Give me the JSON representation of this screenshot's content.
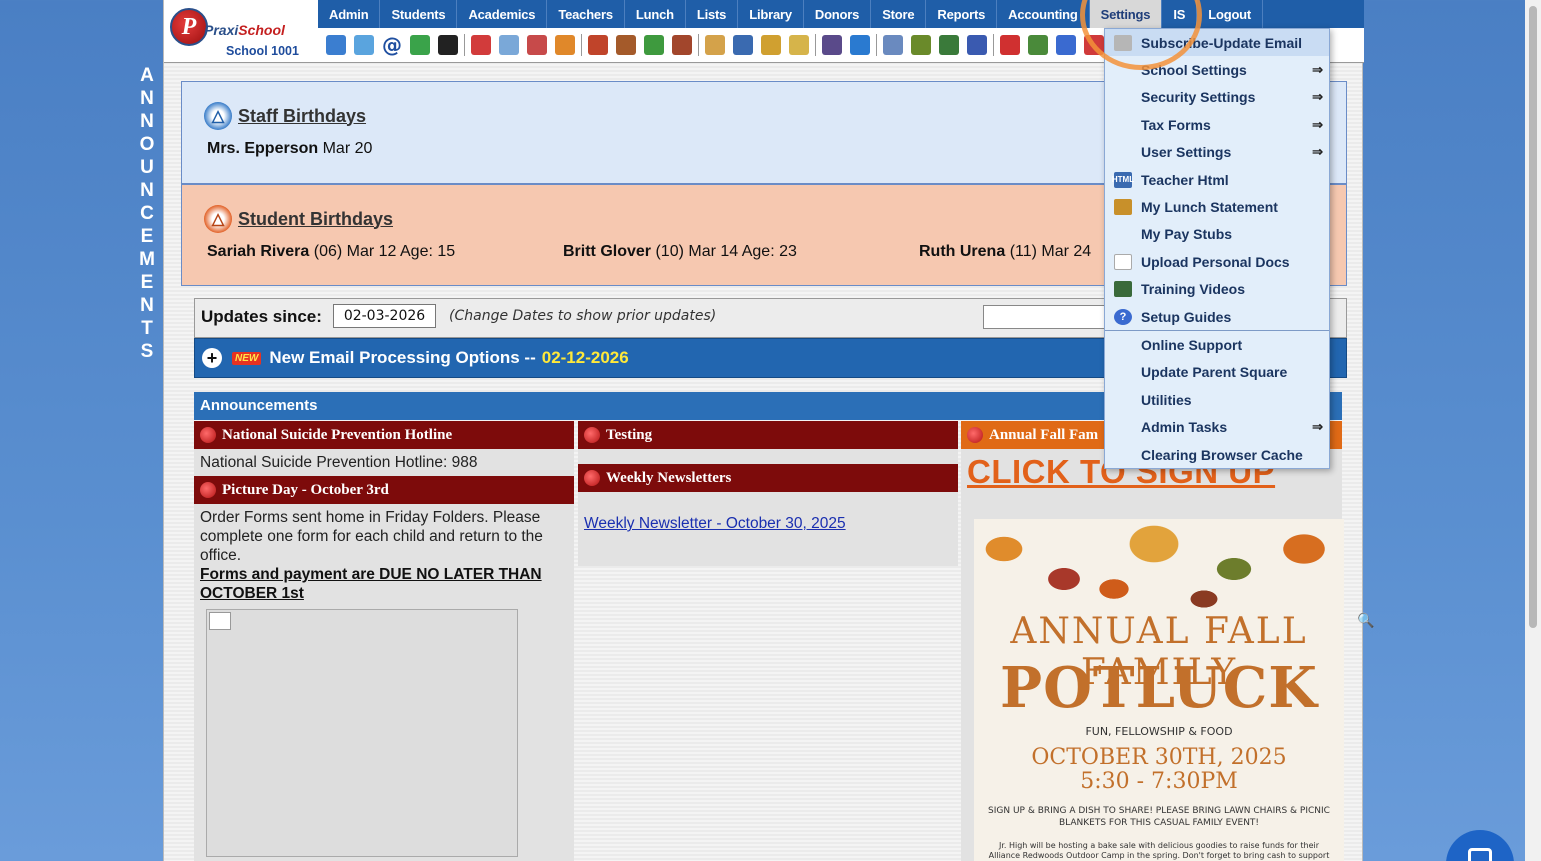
{
  "side_label": "ANNOUNCEMENTS",
  "logo": {
    "brand_a": "Praxi",
    "brand_b": "School",
    "school": "School 1001"
  },
  "menu": [
    "Admin",
    "Students",
    "Academics",
    "Teachers",
    "Lunch",
    "Lists",
    "Library",
    "Donors",
    "Store",
    "Reports",
    "Accounting",
    "Settings",
    "IS",
    "Logout"
  ],
  "icons": [
    "search-icon",
    "calendar-grid-icon",
    "email-at-icon",
    "chat-icon",
    "phone-icon",
    "flag-icon",
    "report-icon",
    "calendar-icon",
    "megaphone-icon",
    "student-add-icon",
    "staff-icon",
    "money-icon",
    "family-icon",
    "lunch-icon",
    "book-icon",
    "broom-icon",
    "import-icon",
    "user-icon",
    "clock-icon",
    "grid-icon",
    "barcode-icon",
    "printer-icon",
    "ap-icon",
    "pdf-icon",
    "cash-icon",
    "help-icon",
    "power-icon"
  ],
  "staff_birthdays": {
    "title": "Staff Birthdays",
    "entries": [
      {
        "name": "Mrs. Epperson",
        "date": "Mar 20"
      }
    ]
  },
  "student_birthdays": {
    "title": "Student Birthdays",
    "entries": [
      {
        "name": "Sariah Rivera",
        "grade": "(06)",
        "info": "Mar 12 Age: 15"
      },
      {
        "name": "Britt Glover",
        "grade": "(10)",
        "info": "Mar 14 Age: 23"
      },
      {
        "name": "Ruth Urena",
        "grade": "(11)",
        "info": "Mar 24"
      }
    ]
  },
  "updates": {
    "label": "Updates since:",
    "date": "02-03-2026",
    "hint": "(Change Dates to show prior updates)"
  },
  "news": {
    "badge": "NEW",
    "title": "New Email Processing Options --",
    "date": "02-12-2026"
  },
  "announcements": {
    "header": "Announcements",
    "col1": [
      {
        "title": "National Suicide Prevention Hotline",
        "body": "National Suicide Prevention Hotline: 988"
      },
      {
        "title": "Picture Day - October 3rd",
        "body": "Order Forms sent home in Friday Folders. Please complete one form for each child and return to the office.",
        "bold": "Forms and payment are DUE NO LATER THAN OCTOBER 1st"
      }
    ],
    "col2": [
      {
        "title": "Testing"
      },
      {
        "title": "Weekly Newsletters",
        "link": "Weekly Newsletter - October 30, 2025"
      }
    ],
    "col3": {
      "title": "Annual Fall Fam",
      "signup": "CLICK TO SIGN UP",
      "poster": {
        "line1": "ANNUAL FALL FAMILY",
        "line2": "POTLUCK",
        "line3": "FUN, FELLOWSHIP & FOOD",
        "line4": "OCTOBER 30TH, 2025",
        "line5": "5:30 - 7:30PM",
        "line6": "SIGN UP & BRING A DISH TO SHARE! PLEASE BRING LAWN CHAIRS & PICNIC BLANKETS FOR THIS CASUAL FAMILY EVENT!",
        "line7": "Jr. High will be hosting a bake sale with delicious goodies to raise funds for their Alliance Redwoods Outdoor Camp in the spring. Don't forget to bring cash to support"
      }
    }
  },
  "settings_menu": [
    {
      "label": "Subscribe-Update Email",
      "icon": "email-icon",
      "arrow": false
    },
    {
      "label": "School Settings",
      "icon": "",
      "arrow": true
    },
    {
      "label": "Security Settings",
      "icon": "",
      "arrow": true
    },
    {
      "label": "Tax Forms",
      "icon": "",
      "arrow": true
    },
    {
      "label": "User Settings",
      "icon": "",
      "arrow": true
    },
    {
      "label": "Teacher Html",
      "icon": "html-icon",
      "arrow": false
    },
    {
      "label": "My Lunch Statement",
      "icon": "lunch-icon",
      "arrow": false
    },
    {
      "label": "My Pay Stubs",
      "icon": "",
      "arrow": false
    },
    {
      "label": "Upload Personal Docs",
      "icon": "document-icon",
      "arrow": false
    },
    {
      "label": "Training Videos",
      "icon": "film-icon",
      "arrow": false
    },
    {
      "label": "Setup Guides",
      "icon": "help-icon",
      "arrow": false
    },
    {
      "label": "Online Support",
      "icon": "",
      "arrow": false
    },
    {
      "label": "Update Parent Square",
      "icon": "",
      "arrow": false
    },
    {
      "label": "Utilities",
      "icon": "",
      "arrow": false
    },
    {
      "label": "Admin Tasks",
      "icon": "",
      "arrow": true
    },
    {
      "label": "Clearing Browser Cache",
      "icon": "",
      "arrow": false
    }
  ],
  "colors": {
    "menu_blue": "#1f5ea8",
    "accent_orange": "#e2611a",
    "dark_red": "#7d0b0b"
  }
}
